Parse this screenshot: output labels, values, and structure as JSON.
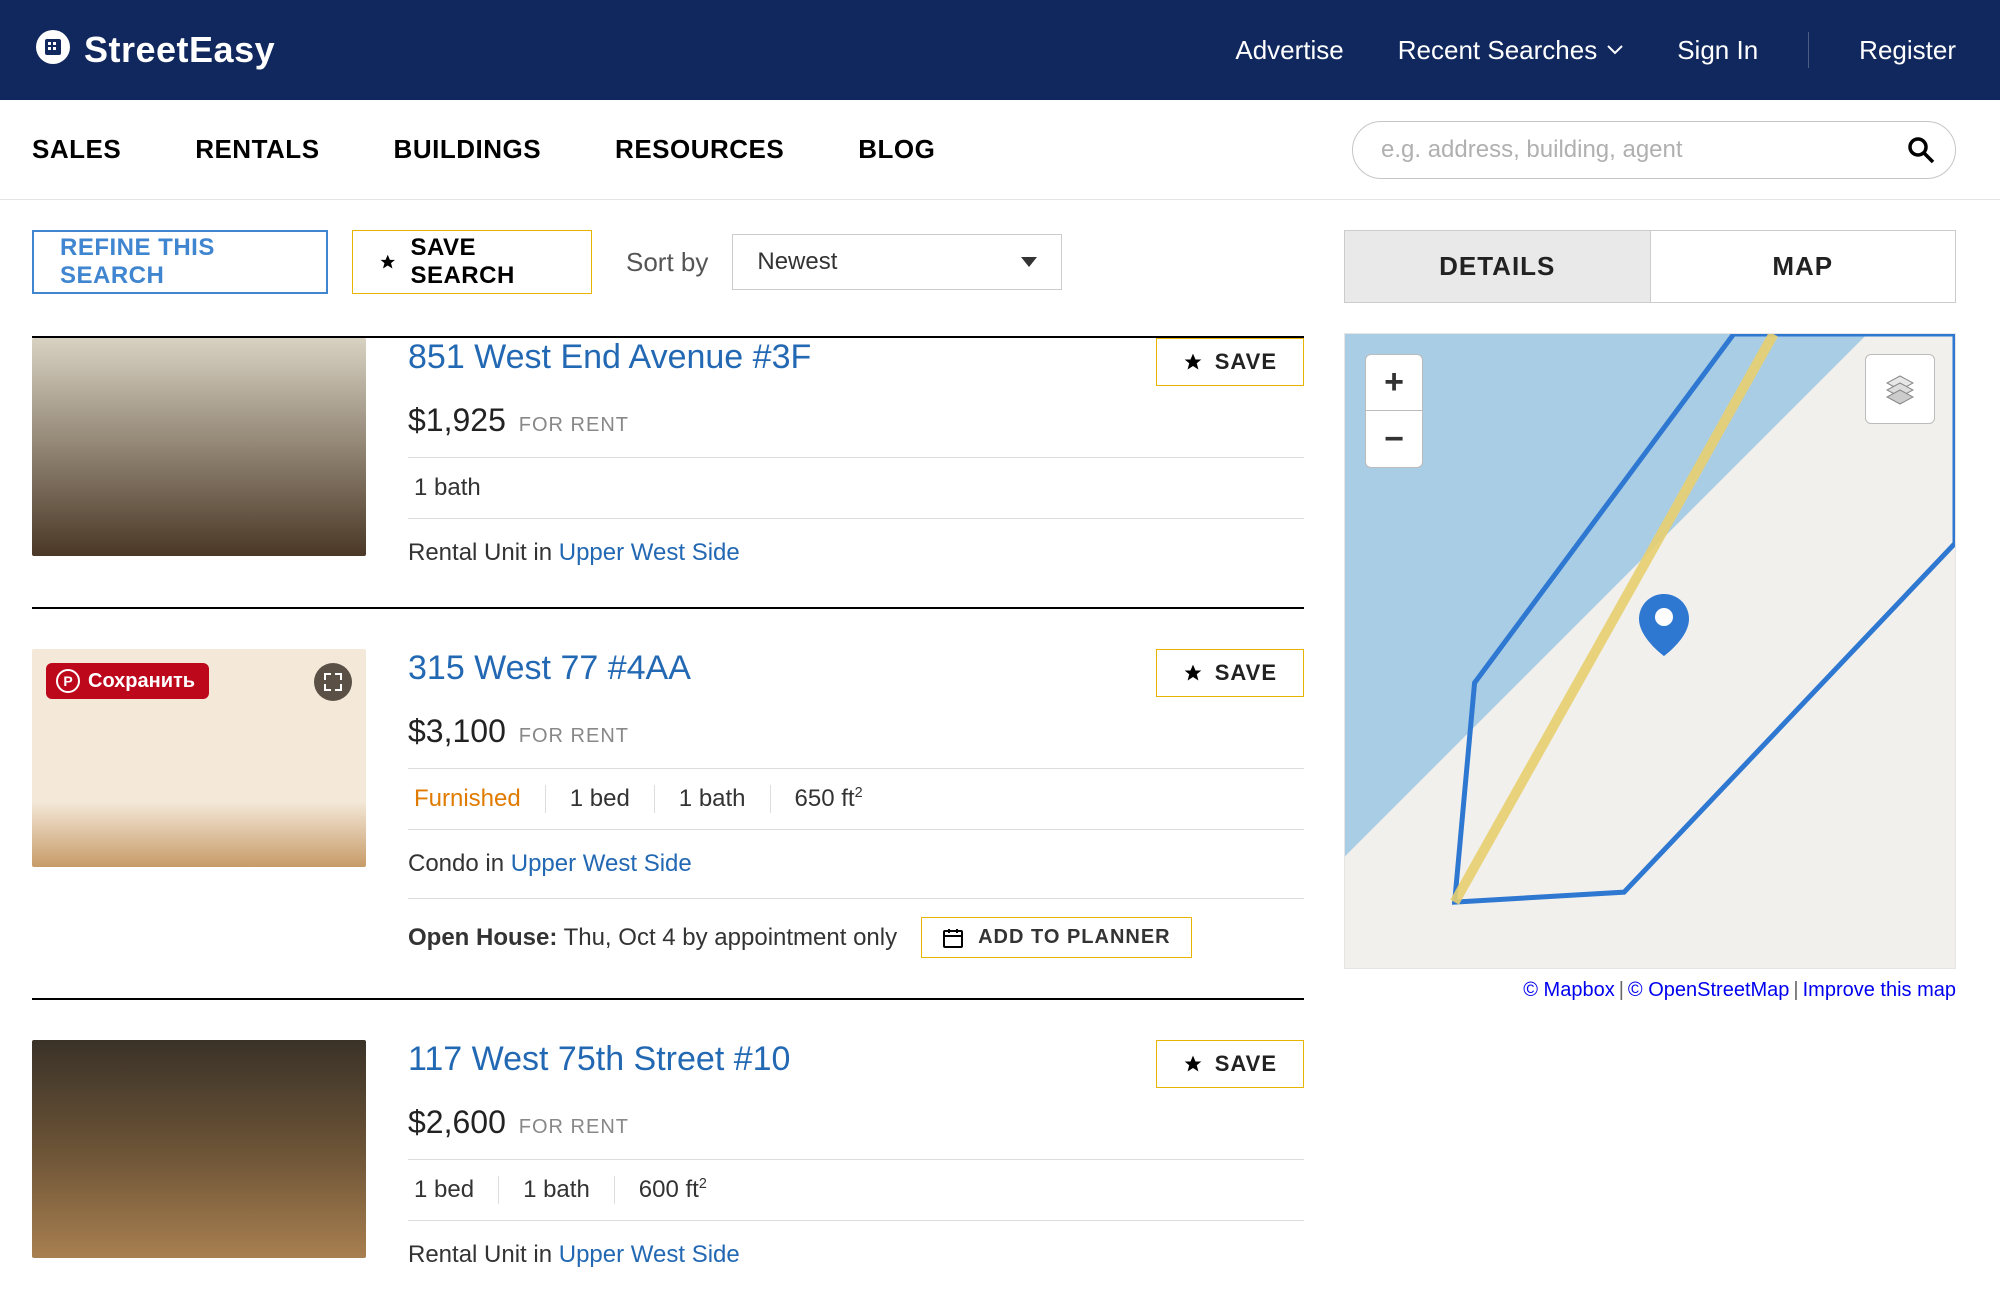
{
  "brand": "StreetEasy",
  "topbar": {
    "advertise": "Advertise",
    "recent": "Recent Searches",
    "signin": "Sign In",
    "register": "Register"
  },
  "nav": {
    "sales": "SALES",
    "rentals": "RENTALS",
    "buildings": "BUILDINGS",
    "resources": "RESOURCES",
    "blog": "BLOG",
    "search_placeholder": "e.g. address, building, agent"
  },
  "toolbar": {
    "refine": "REFINE THIS SEARCH",
    "save_search": "SAVE SEARCH",
    "sort_label": "Sort by",
    "sort_value": "Newest"
  },
  "save_label": "SAVE",
  "add_planner": "ADD TO PLANNER",
  "pin_label": "Сохранить",
  "listings": [
    {
      "title": "851 West End Avenue #3F",
      "price": "$1,925",
      "for_rent": "FOR RENT",
      "specs": [
        "1 bath"
      ],
      "loc_prefix": "Rental Unit in ",
      "loc_link": "Upper West Side"
    },
    {
      "title": "315 West 77 #4AA",
      "price": "$3,100",
      "for_rent": "FOR RENT",
      "furnished": "Furnished",
      "specs": [
        "1 bed",
        "1 bath",
        "650 ft²"
      ],
      "loc_prefix": "Condo in ",
      "loc_link": "Upper West Side",
      "openhouse_label": "Open House:",
      "openhouse_text": "Thu, Oct 4  by appointment only"
    },
    {
      "title": "117 West 75th Street #10",
      "price": "$2,600",
      "for_rent": "FOR RENT",
      "specs": [
        "1 bed",
        "1 bath",
        "600 ft²"
      ],
      "loc_prefix": "Rental Unit in ",
      "loc_link": "Upper West Side"
    }
  ],
  "right": {
    "tab_details": "DETAILS",
    "tab_map": "MAP",
    "credit1": "© Mapbox",
    "credit2": "© OpenStreetMap",
    "credit3": "Improve this map"
  }
}
